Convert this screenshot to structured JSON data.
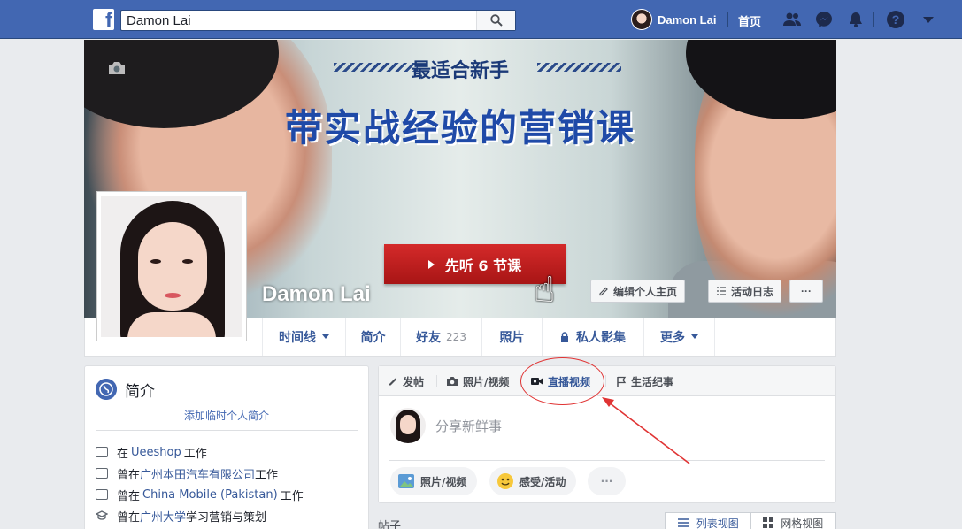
{
  "topbar": {
    "search_value": "Damon Lai",
    "user_name": "Damon Lai",
    "home_label": "首页"
  },
  "cover": {
    "banner_top": "最适合新手",
    "banner_main": "带实战经验的营销课",
    "cta_label": "先听 6 节课",
    "profile_name": "Damon Lai",
    "edit_profile_label": "编辑个人主页",
    "activity_log_label": "活动日志",
    "more_label": "···"
  },
  "tabs": [
    {
      "label": "时间线"
    },
    {
      "label": "简介"
    },
    {
      "label": "好友",
      "count": "223"
    },
    {
      "label": "照片"
    },
    {
      "label": "私人影集"
    },
    {
      "label": "更多"
    }
  ],
  "intro": {
    "title": "简介",
    "add_bio": "添加临时个人简介",
    "rows": [
      {
        "prefix": "在",
        "link": "Ueeshop",
        "suffix": "工作"
      },
      {
        "prefix": "曾在",
        "link": "广州本田汽车有限公司",
        "suffix": "工作"
      },
      {
        "prefix": "曾在",
        "link": "China Mobile (Pakistan)",
        "suffix": "工作"
      },
      {
        "prefix": "曾在",
        "link": "广州大学",
        "suffix": "学习营销与策划"
      }
    ]
  },
  "composer": {
    "tabs": [
      "发帖",
      "照片/视频",
      "直播视频",
      "生活纪事"
    ],
    "placeholder": "分享新鲜事",
    "pills": [
      "照片/视频",
      "感受/活动",
      "···"
    ]
  },
  "posts": {
    "label": "帖子",
    "list_view": "列表视图",
    "grid_view": "网格视图"
  },
  "colors": {
    "brand_blue": "#4267b2",
    "link_blue": "#365899",
    "annotation_red": "#e03434"
  }
}
